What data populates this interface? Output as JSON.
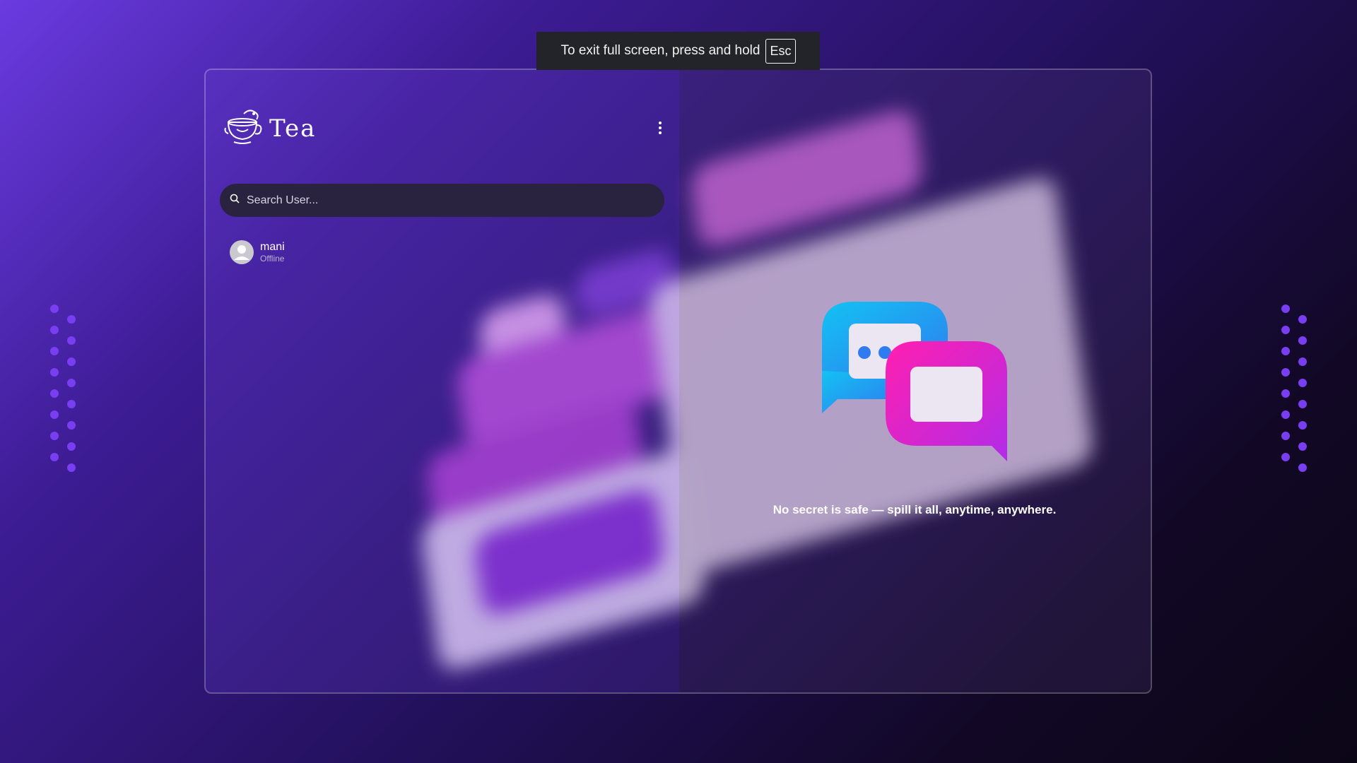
{
  "fullscreen_notice": {
    "text": "To exit full screen, press and hold",
    "key": "Esc"
  },
  "app": {
    "name": "Tea"
  },
  "search": {
    "placeholder": "Search User..."
  },
  "users": [
    {
      "name": "mani",
      "status": "Offline"
    }
  ],
  "welcome": {
    "tagline": "No secret is safe — spill it all, anytime, anywhere."
  },
  "icons": {
    "menu": "more-vertical-icon",
    "search": "search-icon",
    "logo": "teacup-logo-icon",
    "hero": "chat-bubbles-icon"
  },
  "colors": {
    "accent_blue": "#1aa7f5",
    "accent_pink": "#e01fc8",
    "dot_purple": "#7a3ef2"
  }
}
